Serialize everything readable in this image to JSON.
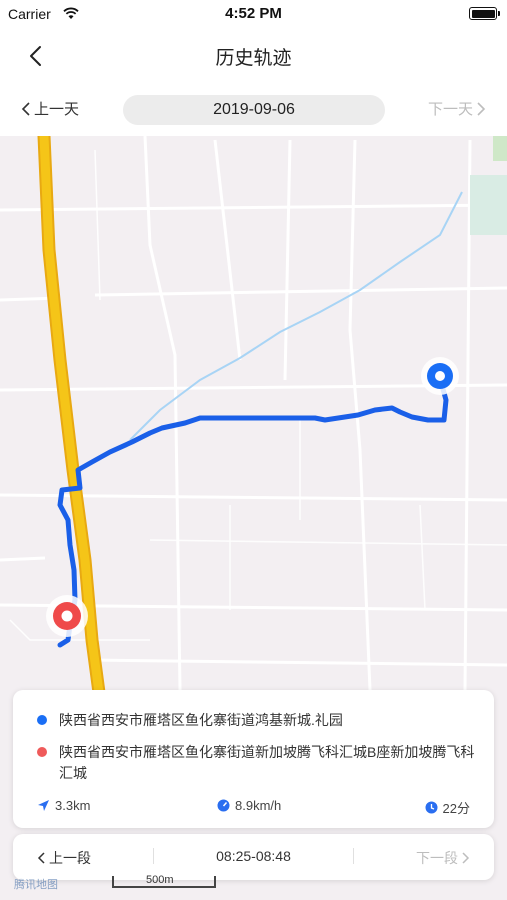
{
  "status_bar": {
    "carrier": "Carrier",
    "time": "4:52 PM"
  },
  "nav": {
    "title": "历史轨迹"
  },
  "date_bar": {
    "prev_day": "上一天",
    "date": "2019-09-06",
    "next_day": "下一天"
  },
  "map": {
    "logo": "腾讯地图",
    "scale": "500m"
  },
  "trip": {
    "start_address": "陕西省西安市雁塔区鱼化寨街道鸿基新城.礼园",
    "end_address": "陕西省西安市雁塔区鱼化寨街道新加坡腾飞科汇城B座新加坡腾飞科汇城",
    "distance": "3.3km",
    "speed": "8.9km/h",
    "duration": "22分"
  },
  "segment": {
    "prev": "上一段",
    "time_range": "08:25-08:48",
    "next": "下一段"
  },
  "colors": {
    "route": "#1a5fe8",
    "start_marker": "#1a6ef5",
    "end_marker": "#ef4a4a",
    "highway": "#f5c518"
  },
  "icons": {
    "back": "chevron-left-icon",
    "wifi": "wifi-icon",
    "battery": "battery-icon",
    "distance": "navigation-arrow-icon",
    "speed": "speedometer-icon",
    "duration": "clock-icon"
  }
}
